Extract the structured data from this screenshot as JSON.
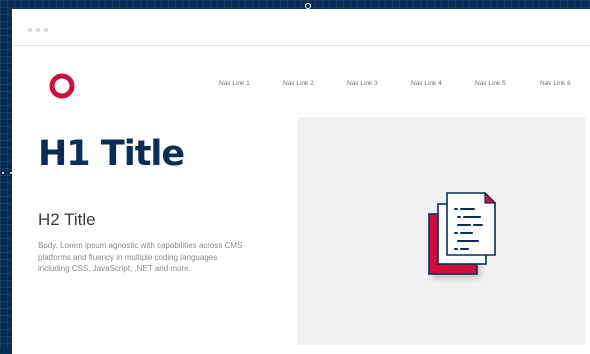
{
  "colors": {
    "blueprint": "#082e57",
    "brand_navy": "#082e57",
    "brand_red": "#d0103a",
    "panel": "#f1f1f1",
    "nav_text": "#707070"
  },
  "logo": {
    "icon": "ring-logo-icon"
  },
  "nav": {
    "links": [
      "Nav Link 1",
      "Nav Link 2",
      "Nav Link 3",
      "Nav Link 4",
      "Nav Link 5",
      "Nav Link 6"
    ]
  },
  "hero": {
    "h1": "H1 Title",
    "h2": "H2 Title",
    "body": "Body. Lorem ipsum agnostic with capabilities across CMS platforms and fluency in multiple coding languages including CSS, JavaScript, .NET and more."
  },
  "illustration": {
    "icon": "documents-icon"
  }
}
